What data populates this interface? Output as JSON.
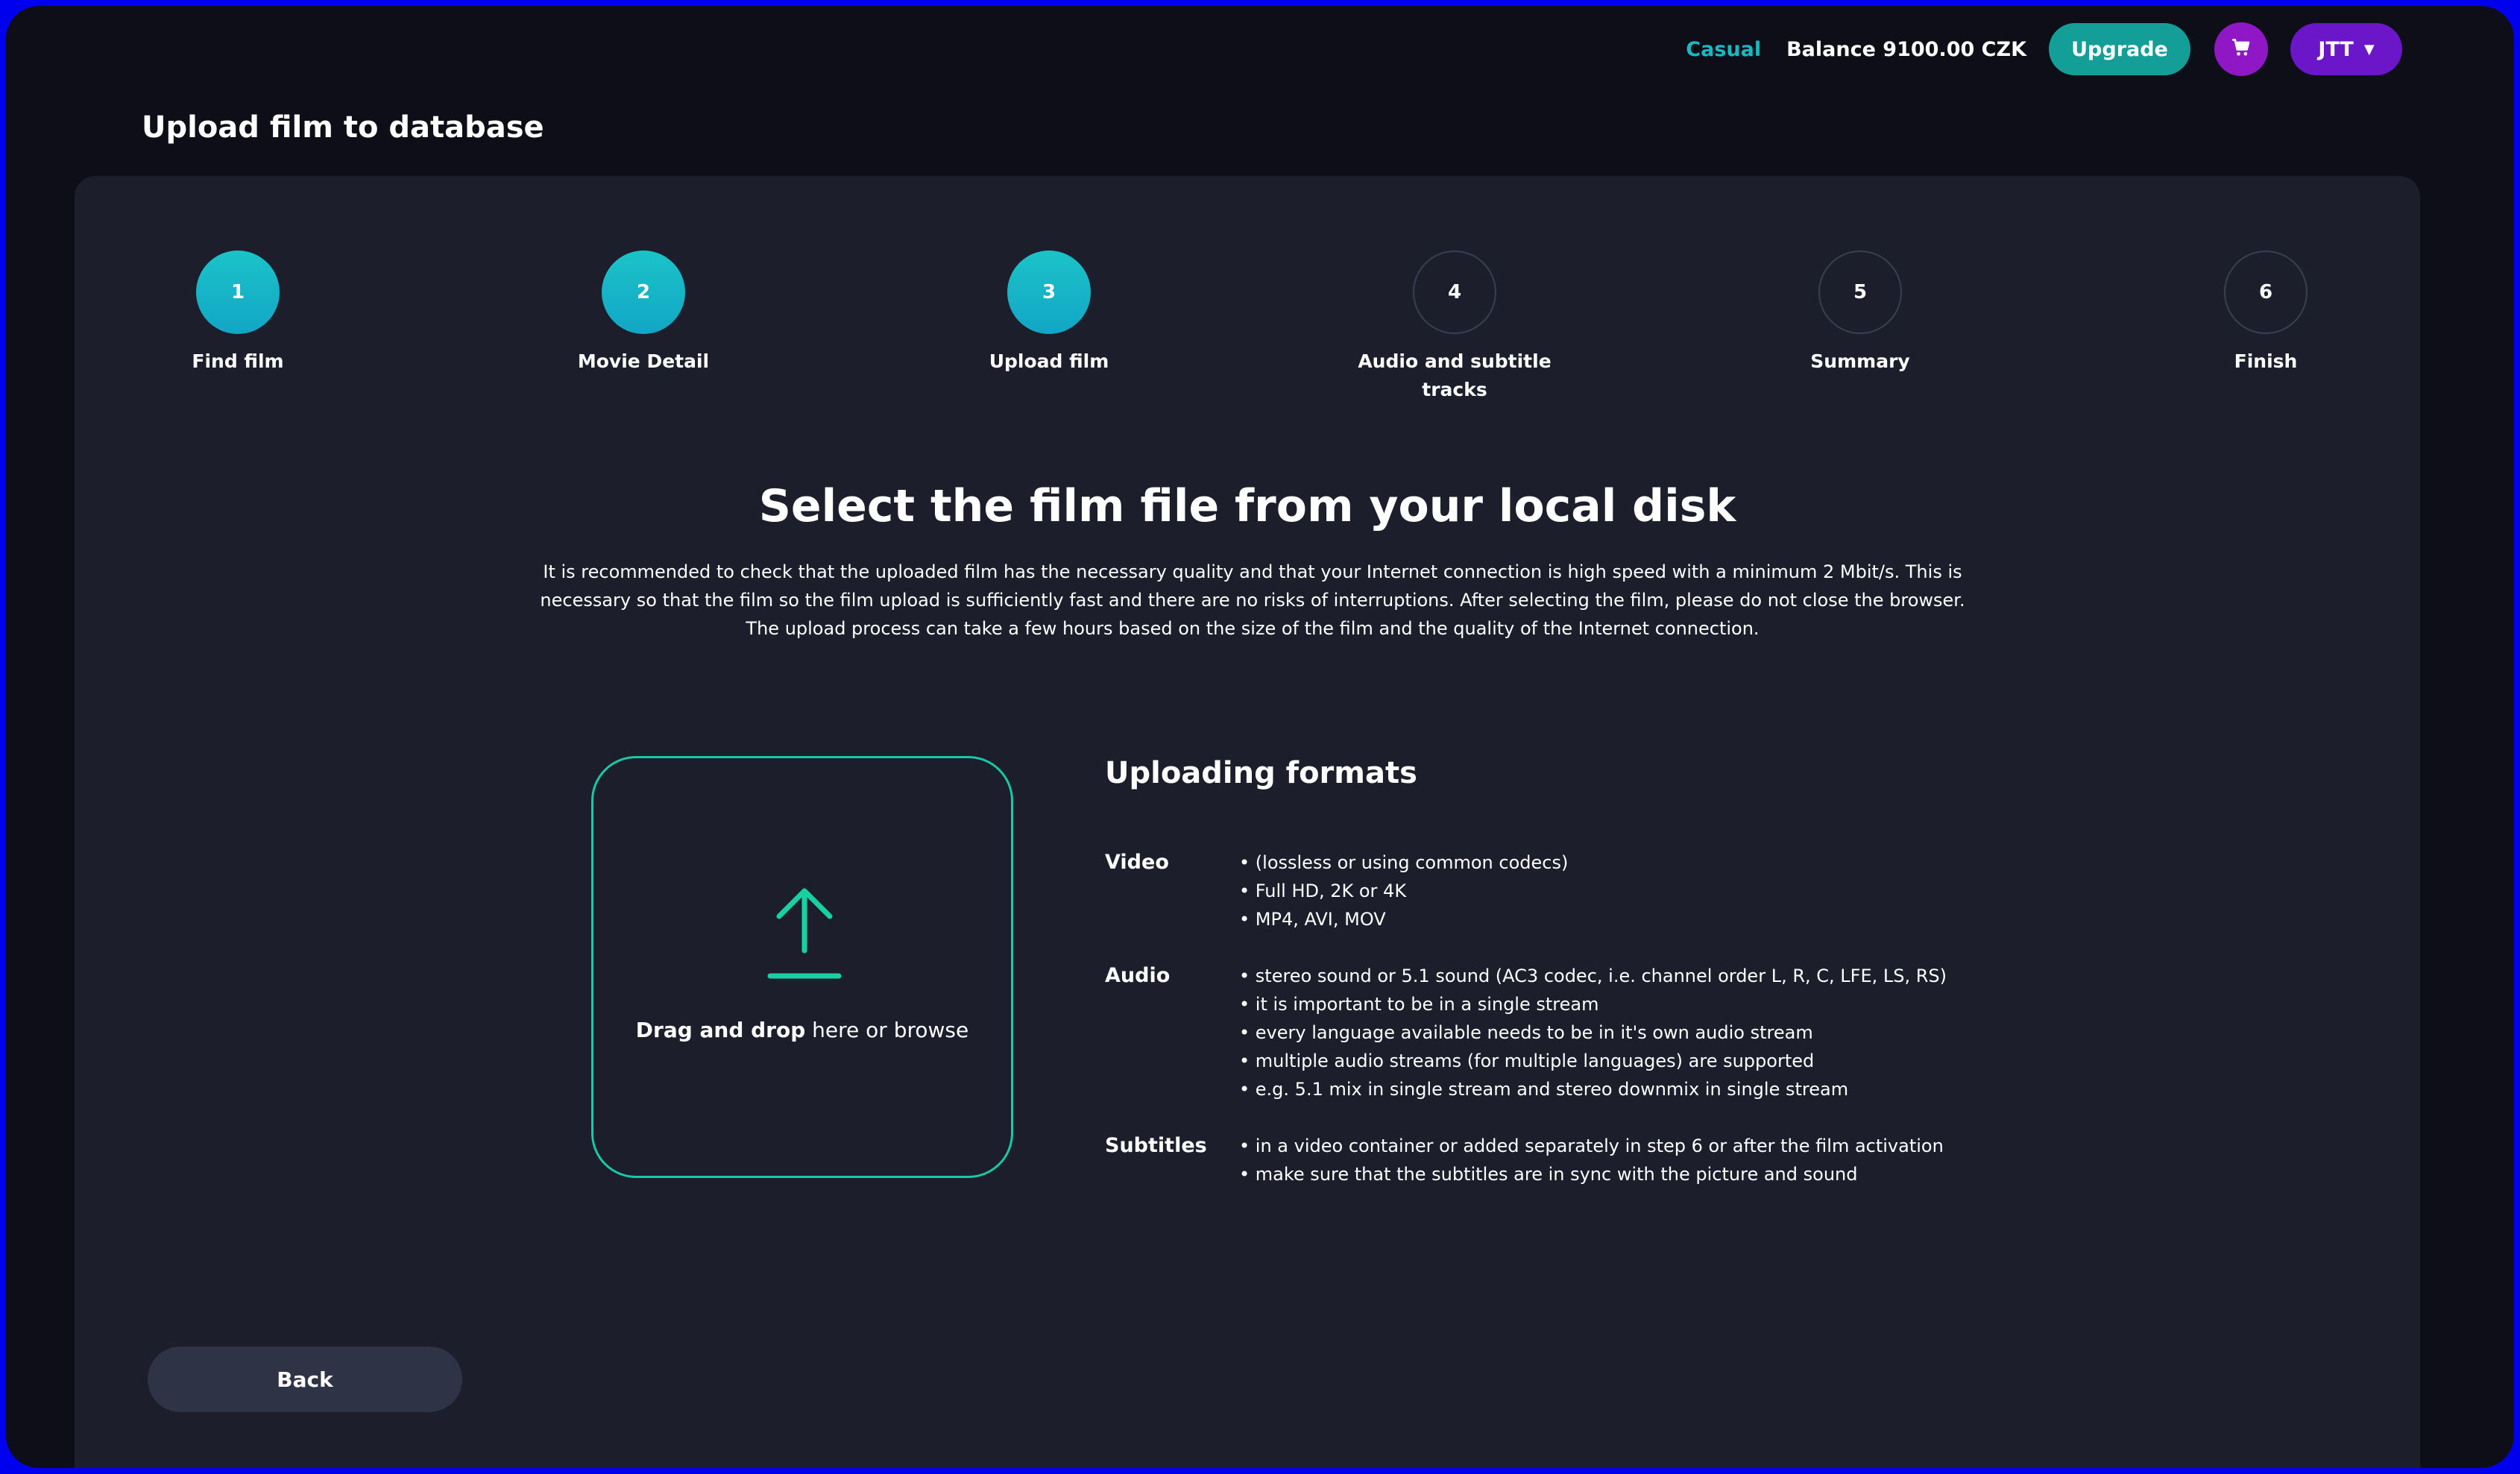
{
  "header": {
    "plan": "Casual",
    "balance": "Balance 9100.00 CZK",
    "upgrade_label": "Upgrade",
    "cart_icon": "cart-icon",
    "user_label": "JTT",
    "user_caret_icon": "chevron-down-icon"
  },
  "page": {
    "title": "Upload film to database"
  },
  "steps": [
    {
      "number": "1",
      "label": "Find film",
      "state": "completed"
    },
    {
      "number": "2",
      "label": "Movie Detail",
      "state": "completed"
    },
    {
      "number": "3",
      "label": "Upload film",
      "state": "current"
    },
    {
      "number": "4",
      "label": "Audio and subtitle tracks",
      "state": "upcoming"
    },
    {
      "number": "5",
      "label": "Summary",
      "state": "upcoming"
    },
    {
      "number": "6",
      "label": "Finish",
      "state": "upcoming"
    }
  ],
  "main": {
    "heading": "Select the film file from your local disk",
    "intro": "It is recommended to check that the uploaded film has the necessary quality and that your Internet connection is high speed with a minimum 2 Mbit/s. This is necessary so that the film so the film upload is sufficiently fast and there are no risks of interruptions. After selecting the film, please do not close the browser. The upload process can take a few hours based on the size of the film and the quality of the Internet connection.",
    "dropzone": {
      "icon": "upload-icon",
      "bold_text": "Drag and drop",
      "rest_text": " here or browse"
    },
    "formats": {
      "title": "Uploading formats",
      "groups": [
        {
          "label": "Video",
          "items": [
            "• (lossless or using common codecs)",
            "• Full HD, 2K or 4K",
            "• MP4, AVI, MOV"
          ]
        },
        {
          "label": "Audio",
          "items": [
            "• stereo sound or 5.1 sound (AC3 codec, i.e. channel order L, R, C, LFE, LS, RS)",
            "• it is important to be in a single stream",
            "• every language available needs to be in it's own audio stream",
            "• multiple audio streams (for multiple languages) are supported",
            "• e.g. 5.1 mix in single stream and stereo downmix in single stream"
          ]
        },
        {
          "label": "Subtitles",
          "items": [
            "• in a video container or added separately in step 6 or after the film activation",
            "• make sure that the subtitles are in sync with the picture and sound"
          ]
        }
      ]
    }
  },
  "footer": {
    "back_label": "Back"
  },
  "colors": {
    "background": "#0d0e17",
    "panel": "#1c1f2b",
    "accent_teal": "#18b8c4",
    "upgrade": "#139e98",
    "cart": "#8f17c6",
    "user": "#6b16c9",
    "dropzone_border": "#17c9a5"
  }
}
